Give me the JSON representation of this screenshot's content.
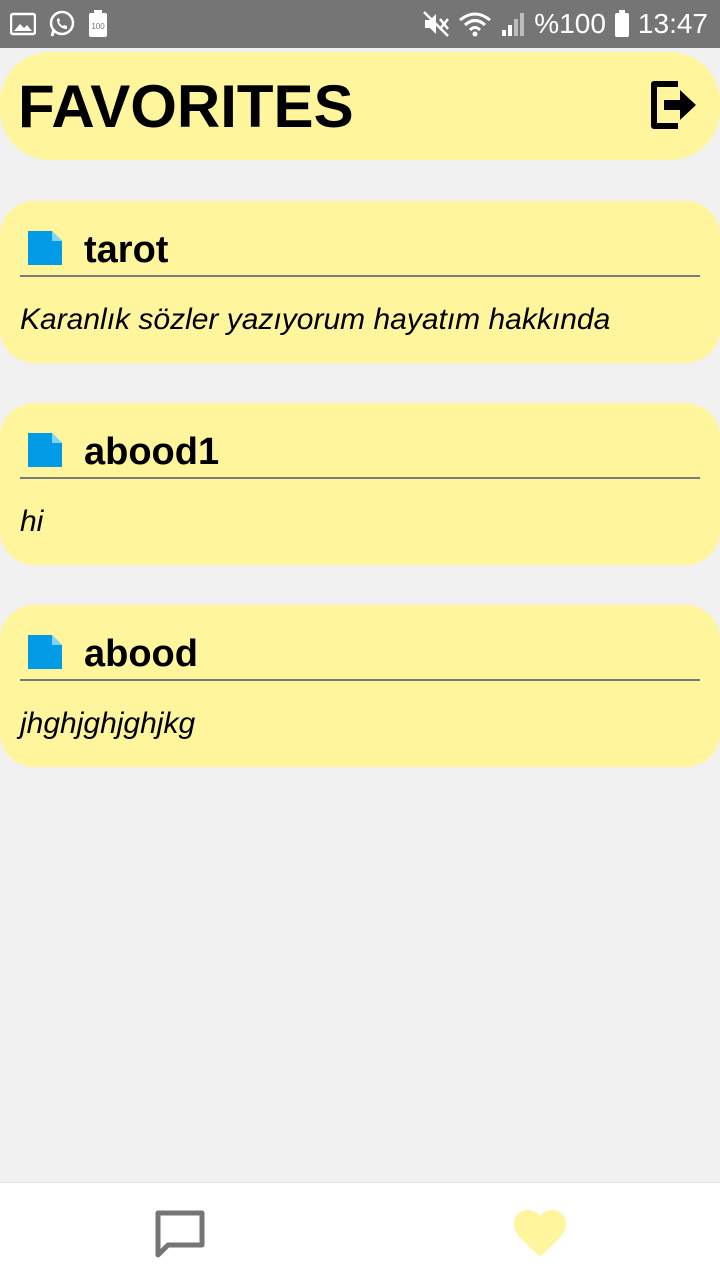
{
  "status_bar": {
    "battery_text": "%100",
    "time": "13:47",
    "left_icons": [
      "image-icon",
      "whatsapp-icon",
      "battery-100-icon"
    ],
    "right_icons": [
      "mute-icon",
      "wifi-icon",
      "signal-icon",
      "battery-icon"
    ]
  },
  "header": {
    "title": "FAVORITES",
    "logout_icon": "logout-icon",
    "background": "#fff59d"
  },
  "favorites": [
    {
      "title": "tarot",
      "text": "Karanlık sözler yazıyorum hayatım hakkında",
      "icon": "document-icon"
    },
    {
      "title": "abood1",
      "text": "hi",
      "icon": "document-icon"
    },
    {
      "title": "abood",
      "text": "jhghjghjghjkg",
      "icon": "document-icon"
    }
  ],
  "bottom_nav": {
    "items": [
      {
        "name": "chat",
        "icon": "chat-icon",
        "active": false
      },
      {
        "name": "favorites",
        "icon": "heart-icon",
        "active": true
      }
    ],
    "active_color": "#fff59d",
    "inactive_color": "#757575"
  },
  "colors": {
    "card_bg": "#fff59d",
    "icon_blue": "#039be5",
    "status_bar": "#757575",
    "page_bg": "#f1f1f1"
  }
}
